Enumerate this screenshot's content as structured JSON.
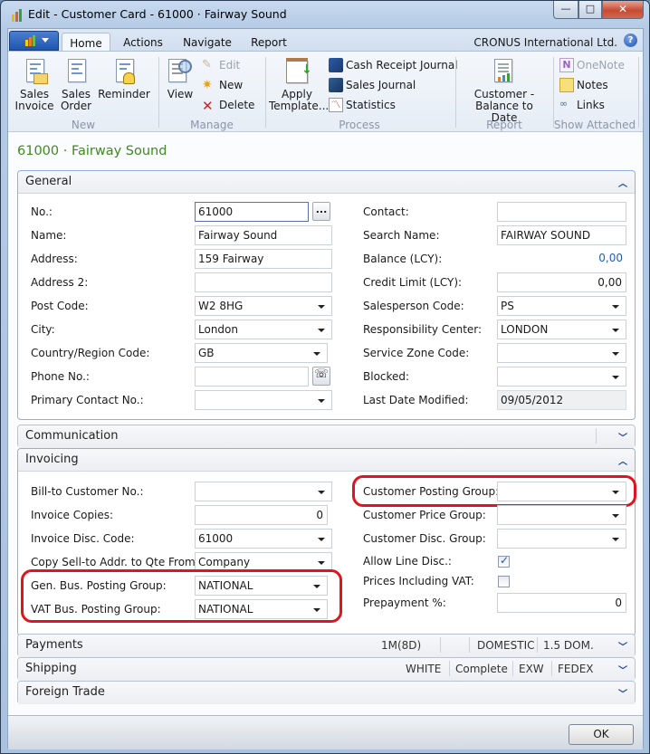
{
  "window": {
    "title": "Edit - Customer Card - 61000 · Fairway Sound",
    "controls": {
      "minimize": "—",
      "maximize": "□",
      "close": "✕"
    }
  },
  "ribbon": {
    "tabs": [
      {
        "label": "Home",
        "active": true
      },
      {
        "label": "Actions"
      },
      {
        "label": "Navigate"
      },
      {
        "label": "Report"
      }
    ],
    "company": "CRONUS International Ltd.",
    "help_glyph": "?",
    "groups": {
      "new": {
        "label": "New",
        "buttons": [
          {
            "label1": "Sales",
            "label2": "Invoice"
          },
          {
            "label1": "Sales",
            "label2": "Order"
          },
          {
            "label1": "Reminder",
            "label2": ""
          }
        ]
      },
      "manage": {
        "label": "Manage",
        "view": "View",
        "edit": "Edit",
        "new": "New",
        "delete": "Delete"
      },
      "process": {
        "label": "Process",
        "apply1": "Apply",
        "apply2": "Template...",
        "cash_receipt": "Cash Receipt Journal",
        "sales_journal": "Sales Journal",
        "statistics": "Statistics"
      },
      "report": {
        "label": "Report",
        "btn1": "Customer -",
        "btn2": "Balance to Date"
      },
      "show_attached": {
        "label": "Show Attached",
        "onenote": "OneNote",
        "notes": "Notes",
        "links": "Links"
      }
    }
  },
  "page_title": "61000 · Fairway Sound",
  "general": {
    "title": "General",
    "left": [
      {
        "label": "No.:",
        "value": "61000"
      },
      {
        "label": "Name:",
        "value": "Fairway Sound"
      },
      {
        "label": "Address:",
        "value": "159 Fairway"
      },
      {
        "label": "Address 2:",
        "value": ""
      },
      {
        "label": "Post Code:",
        "value": "W2 8HG"
      },
      {
        "label": "City:",
        "value": "London"
      },
      {
        "label": "Country/Region Code:",
        "value": "GB"
      },
      {
        "label": "Phone No.:",
        "value": ""
      },
      {
        "label": "Primary Contact No.:",
        "value": ""
      }
    ],
    "right": [
      {
        "label": "Contact:",
        "value": ""
      },
      {
        "label": "Search Name:",
        "value": "FAIRWAY SOUND"
      },
      {
        "label": "Balance (LCY):",
        "value": "0,00"
      },
      {
        "label": "Credit Limit (LCY):",
        "value": "0,00"
      },
      {
        "label": "Salesperson Code:",
        "value": "PS"
      },
      {
        "label": "Responsibility Center:",
        "value": "LONDON"
      },
      {
        "label": "Service Zone Code:",
        "value": ""
      },
      {
        "label": "Blocked:",
        "value": ""
      },
      {
        "label": "Last Date Modified:",
        "value": "09/05/2012"
      }
    ],
    "assist_label": "..."
  },
  "communication": {
    "title": "Communication"
  },
  "invoicing": {
    "title": "Invoicing",
    "left": [
      {
        "label": "Bill-to Customer No.:",
        "value": ""
      },
      {
        "label": "Invoice Copies:",
        "value": "0"
      },
      {
        "label": "Invoice Disc. Code:",
        "value": "61000"
      },
      {
        "label": "Copy Sell-to Addr. to Qte From:",
        "value": "Company"
      },
      {
        "label": "Gen. Bus. Posting Group:",
        "value": "NATIONAL"
      },
      {
        "label": "VAT Bus. Posting Group:",
        "value": "NATIONAL"
      }
    ],
    "right": [
      {
        "label": "Customer Posting Group:",
        "value": ""
      },
      {
        "label": "Customer Price Group:",
        "value": ""
      },
      {
        "label": "Customer Disc. Group:",
        "value": ""
      },
      {
        "label": "Allow Line Disc.:",
        "checked": true
      },
      {
        "label": "Prices Including VAT:",
        "checked": false
      },
      {
        "label": "Prepayment %:",
        "value": "0"
      }
    ]
  },
  "payments": {
    "title": "Payments",
    "summary": [
      "1M(8D)",
      "",
      "DOMESTIC",
      "1.5 DOM."
    ]
  },
  "shipping": {
    "title": "Shipping",
    "summary": [
      "WHITE",
      "Complete",
      "EXW",
      "FEDEX"
    ]
  },
  "foreign_trade": {
    "title": "Foreign Trade"
  },
  "footer": {
    "ok": "OK"
  },
  "colors": {
    "page_title": "#3d8a1f",
    "highlight": "#e0141c",
    "balance_value": "#1e5fb6"
  }
}
